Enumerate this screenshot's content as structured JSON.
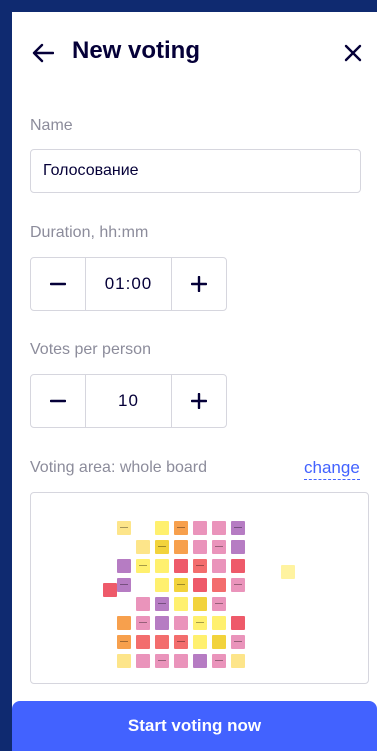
{
  "header": {
    "title": "New voting",
    "back_icon": "arrow-left-icon",
    "close_icon": "close-icon"
  },
  "name": {
    "label": "Name",
    "value": "Голосование"
  },
  "duration": {
    "label": "Duration, hh:mm",
    "value": "01:00",
    "decrement_icon": "minus-icon",
    "increment_icon": "plus-icon"
  },
  "votes": {
    "label": "Votes per person",
    "value": "10",
    "decrement_icon": "minus-icon",
    "increment_icon": "plus-icon"
  },
  "voting_area": {
    "label": "Voting area: whole board",
    "change_label": "change"
  },
  "start_button": {
    "label": "Start voting now"
  },
  "colors": {
    "accent": "#4262ff",
    "text": "#050038",
    "muted": "#8c8c9b",
    "frame": "#0f2a70"
  }
}
